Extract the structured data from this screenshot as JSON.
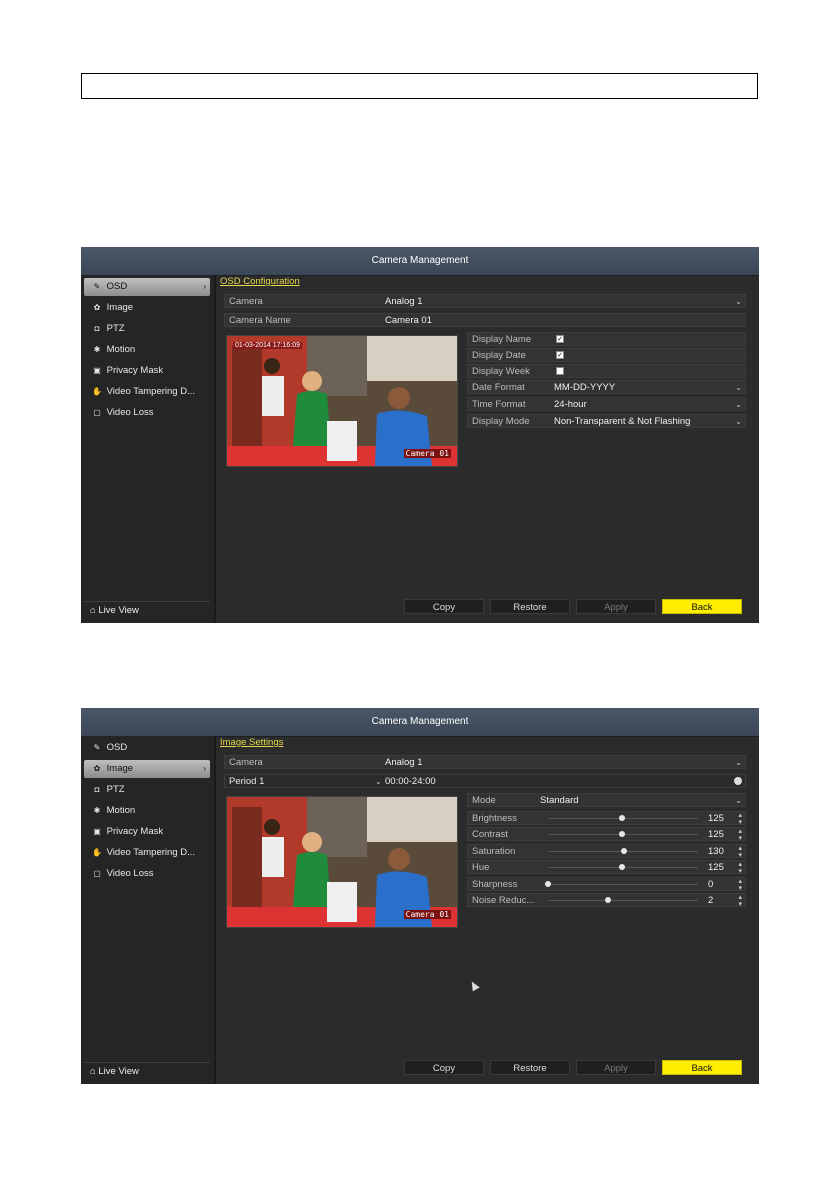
{
  "screen1": {
    "title": "Camera Management",
    "sidebar": {
      "items": [
        {
          "label": "OSD",
          "icon": "osd-icon"
        },
        {
          "label": "Image",
          "icon": "image-icon"
        },
        {
          "label": "PTZ",
          "icon": "ptz-icon"
        },
        {
          "label": "Motion",
          "icon": "motion-icon"
        },
        {
          "label": "Privacy Mask",
          "icon": "privacy-mask-icon"
        },
        {
          "label": "Video Tampering D...",
          "icon": "tampering-icon"
        },
        {
          "label": "Video Loss",
          "icon": "video-loss-icon"
        }
      ],
      "active": 0,
      "live_view": "Live View"
    },
    "section_title": "OSD Configuration",
    "camera_label": "Camera",
    "camera_value": "Analog 1",
    "camera_name_label": "Camera Name",
    "camera_name_value": "Camera 01",
    "preview_timestamp": "01-03-2014 17:16:09",
    "preview_overlay": "Camera 01",
    "options": {
      "display_name": {
        "label": "Display Name",
        "checked": true
      },
      "display_date": {
        "label": "Display Date",
        "checked": true
      },
      "display_week": {
        "label": "Display Week",
        "checked": false
      },
      "date_format": {
        "label": "Date Format",
        "value": "MM-DD-YYYY"
      },
      "time_format": {
        "label": "Time Format",
        "value": "24-hour"
      },
      "display_mode": {
        "label": "Display Mode",
        "value": "Non-Transparent & Not Flashing"
      }
    },
    "buttons": {
      "copy": "Copy",
      "restore": "Restore",
      "apply": "Apply",
      "back": "Back"
    }
  },
  "screen2": {
    "title": "Camera Management",
    "sidebar": {
      "items": [
        {
          "label": "OSD",
          "icon": "osd-icon"
        },
        {
          "label": "Image",
          "icon": "image-icon"
        },
        {
          "label": "PTZ",
          "icon": "ptz-icon"
        },
        {
          "label": "Motion",
          "icon": "motion-icon"
        },
        {
          "label": "Privacy Mask",
          "icon": "privacy-mask-icon"
        },
        {
          "label": "Video Tampering D...",
          "icon": "tampering-icon"
        },
        {
          "label": "Video Loss",
          "icon": "video-loss-icon"
        }
      ],
      "active": 1,
      "live_view": "Live View"
    },
    "section_title": "Image Settings",
    "camera_label": "Camera",
    "camera_value": "Analog 1",
    "period_label": "Period 1",
    "period_value": "00:00-24:00",
    "preview_overlay": "Camera 01",
    "mode_label": "Mode",
    "mode_value": "Standard",
    "sliders": [
      {
        "label": "Brightness",
        "value": 125,
        "max": 255
      },
      {
        "label": "Contrast",
        "value": 125,
        "max": 255
      },
      {
        "label": "Saturation",
        "value": 130,
        "max": 255
      },
      {
        "label": "Hue",
        "value": 125,
        "max": 255
      },
      {
        "label": "Sharpness",
        "value": 0,
        "max": 15
      },
      {
        "label": "Noise Reduc...",
        "value": 2,
        "max": 5
      }
    ],
    "buttons": {
      "copy": "Copy",
      "restore": "Restore",
      "apply": "Apply",
      "back": "Back"
    }
  },
  "colors": {
    "accent_yellow": "#ffee00",
    "section_title": "#e6d84a",
    "titlebar": "#445163"
  }
}
